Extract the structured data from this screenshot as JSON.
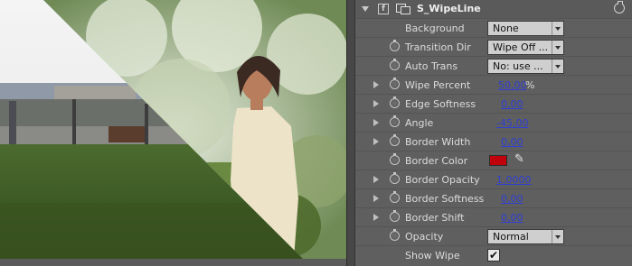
{
  "effect": {
    "name": "S_WipeLine",
    "fx_toggle_label": "f"
  },
  "properties": [
    {
      "label": "Background",
      "type": "dropdown",
      "value": "None",
      "stopwatch": false,
      "twirl": false
    },
    {
      "label": "Transition Dir",
      "type": "dropdown",
      "value": "Wipe Off ...",
      "stopwatch": true,
      "twirl": false
    },
    {
      "label": "Auto Trans",
      "type": "dropdown",
      "value": "No: use ...",
      "stopwatch": true,
      "twirl": false
    },
    {
      "label": "Wipe Percent",
      "type": "number",
      "value": "50,00",
      "suffix": "%",
      "stopwatch": true,
      "twirl": true
    },
    {
      "label": "Edge Softness",
      "type": "number",
      "value": "0,00",
      "stopwatch": true,
      "twirl": true
    },
    {
      "label": "Angle",
      "type": "number",
      "value": "-45,00",
      "stopwatch": true,
      "twirl": true
    },
    {
      "label": "Border Width",
      "type": "number",
      "value": "0,00",
      "stopwatch": true,
      "twirl": true
    },
    {
      "label": "Border Color",
      "type": "color",
      "value": "#c0000b",
      "stopwatch": true,
      "twirl": false
    },
    {
      "label": "Border Opacity",
      "type": "number",
      "value": "1,0000",
      "stopwatch": true,
      "twirl": true
    },
    {
      "label": "Border Softness",
      "type": "number",
      "value": "0,00",
      "stopwatch": true,
      "twirl": true
    },
    {
      "label": "Border Shift",
      "type": "number",
      "value": "0,00",
      "stopwatch": true,
      "twirl": true
    },
    {
      "label": "Opacity",
      "type": "dropdown",
      "value": "Normal",
      "stopwatch": true,
      "twirl": false
    },
    {
      "label": "Show Wipe",
      "type": "checkbox",
      "value": "✔",
      "stopwatch": false,
      "twirl": false
    }
  ],
  "icons": {
    "header_twirl": "chevron-down-icon",
    "effect": "effect-icon",
    "reset": "reset-icon",
    "eyedropper": "eyedropper-icon",
    "stopwatch": "stopwatch-icon"
  },
  "colors": {
    "panel_bg": "#5f5f5f",
    "value_link": "#2f3fd4",
    "border_color_swatch": "#c0000b"
  }
}
